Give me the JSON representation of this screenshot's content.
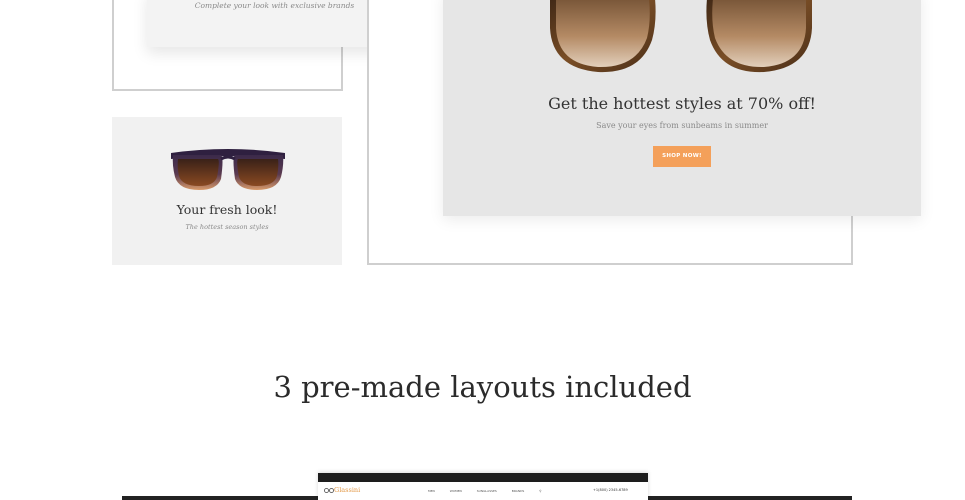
{
  "top_card": {
    "tagline": "Complete your look with exclusive brands"
  },
  "small_card": {
    "title": "Your fresh look!",
    "subtitle": "The hottest season styles"
  },
  "promo_card": {
    "headline": "Get the hottest styles at 70% off!",
    "subline": "Save your eyes from sunbeams in summer",
    "button_label": "SHOP NOW!"
  },
  "section": {
    "title": "3 pre-made layouts included"
  },
  "preview": {
    "logo": "Glassini",
    "nav": [
      "MEN",
      "WOMEN",
      "SUNGLASSES",
      "BRANDS"
    ],
    "phone": "+1(800) 2345-6789"
  },
  "colors": {
    "accent": "#f4a05a",
    "card_bg": "#e6e6e6",
    "text": "#333333"
  },
  "icons": [
    "sunglasses-aviator",
    "sunglasses-wayfarer",
    "glasses-logo-icon",
    "search-icon"
  ]
}
